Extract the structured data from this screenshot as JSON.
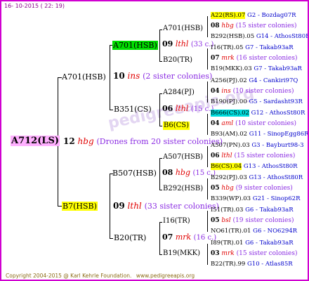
{
  "header": {
    "date": "16- 10-2015 ( 22: 19)"
  },
  "footer": {
    "copyright": "Copyright 2004-2015 @ Karl Kehrle Foundation.",
    "site": "www.pedigreeapis.org"
  },
  "root": {
    "name": "A712(LS)"
  },
  "drone_line": {
    "num": "12",
    "loc": "hbg",
    "desc": "(Drones from 20 sister colonies)"
  },
  "gen1": {
    "top": {
      "name": "A701(HSB)",
      "num": "10",
      "loc": "ins",
      "desc": "(2 sister colonies)"
    },
    "bottom": {
      "name": "B7(HSB)",
      "num": "09",
      "loc": "lthl",
      "desc": "(33 sister colonies)"
    }
  },
  "gen2": {
    "a": {
      "name": "A701(HSB)",
      "num": "09",
      "loc": "lthl",
      "desc": "(33 c.)"
    },
    "b": {
      "name": "B351(CS)",
      "num": "06",
      "loc": "lthl",
      "desc": "(15 c.)"
    },
    "c": {
      "name": "B507(HSB)",
      "num": "08",
      "loc": "hbg",
      "desc": "(15 c.)"
    },
    "d": {
      "name": "B20(TR)",
      "num": "07",
      "loc": "mrk",
      "desc": "(16 c.)"
    }
  },
  "gen3": [
    {
      "name": "A701(HSB)"
    },
    {
      "name": "B20(TR)"
    },
    {
      "name": "A284(PJ)"
    },
    {
      "name": "B6(CS)"
    },
    {
      "name": "A507(HSB)"
    },
    {
      "name": "B292(HSB)"
    },
    {
      "name": "I16(TR)"
    },
    {
      "name": "B19(MKK)"
    }
  ],
  "gen4": [
    {
      "q": "A22(RS)",
      "qn": ".07",
      "code": "G2 - Bozdag07R",
      "num": "08",
      "loc": "hbg",
      "desc": "(15 sister colonies)",
      "d": "B292(HSB)",
      "dn": ".05",
      "dcode": "G14 - AthosSt80R"
    },
    {
      "q": "I16(TR)",
      "qn": ".05",
      "code": "G7 - Takab93aR",
      "num": "07",
      "loc": "mrk",
      "desc": "(16 sister colonies)",
      "d": "B19(MKK)",
      "dn": ".03",
      "dcode": "G7 - Takab93aR"
    },
    {
      "q": "A256(PJ)",
      "qn": ".02",
      "code": "G4 - Cankiri97Q",
      "num": "04",
      "loc": "ins",
      "desc": "(10 sister colonies)",
      "d": "B190(PJ)",
      "dn": ".00",
      "dcode": "G5 - Sardasht93R"
    },
    {
      "q": "B666(CS)",
      "qn": ".02",
      "code": "G12 - AthosSt80R",
      "num": "04",
      "loc": "aml",
      "desc": "(10 sister colonies)",
      "d": "B93(AM)",
      "dn": ".02",
      "dcode": "G11 - SinopEgg86R"
    },
    {
      "q": "A507(PN)",
      "qn": ".03",
      "code": "G3 - Bayburt98-3",
      "num": "06",
      "loc": "lthl",
      "desc": "(15 sister colonies)",
      "d": "B6(CS)",
      "dn": ".04",
      "dcode": "G13 - AthosSt80R"
    },
    {
      "q": "B292(PJ)",
      "qn": ".03",
      "code": "G13 - AthosSt80R",
      "num": "05",
      "loc": "hbg",
      "desc": "(9 sister colonies)",
      "d": "B339(WP)",
      "dn": ".03",
      "dcode": "G21 - Sinop62R"
    },
    {
      "q": "I51(TR)",
      "qn": ".03",
      "code": "G6 - Takab93aR",
      "num": "05",
      "loc": "bsl",
      "desc": "(19 sister colonies)",
      "d": "NO61(TR)",
      "dn": ".01",
      "dcode": "G6 - NO6294R"
    },
    {
      "q": "I89(TR)",
      "qn": ".01",
      "code": "G6 - Takab93aR",
      "num": "03",
      "loc": "mrk",
      "desc": "(15 sister colonies)",
      "d": "B22(TR)",
      "dn": ".99",
      "dcode": "G10 - Atlas85R"
    }
  ],
  "colors": {
    "frame": "#d000d0",
    "yellow": "#ffff00",
    "green": "#00dd00",
    "cyan": "#00dddd",
    "root_bg": "#ffb0ff",
    "red": "#e00000",
    "purple": "#8a2be2",
    "blue": "#0000cc",
    "footer": "#8b6914"
  }
}
